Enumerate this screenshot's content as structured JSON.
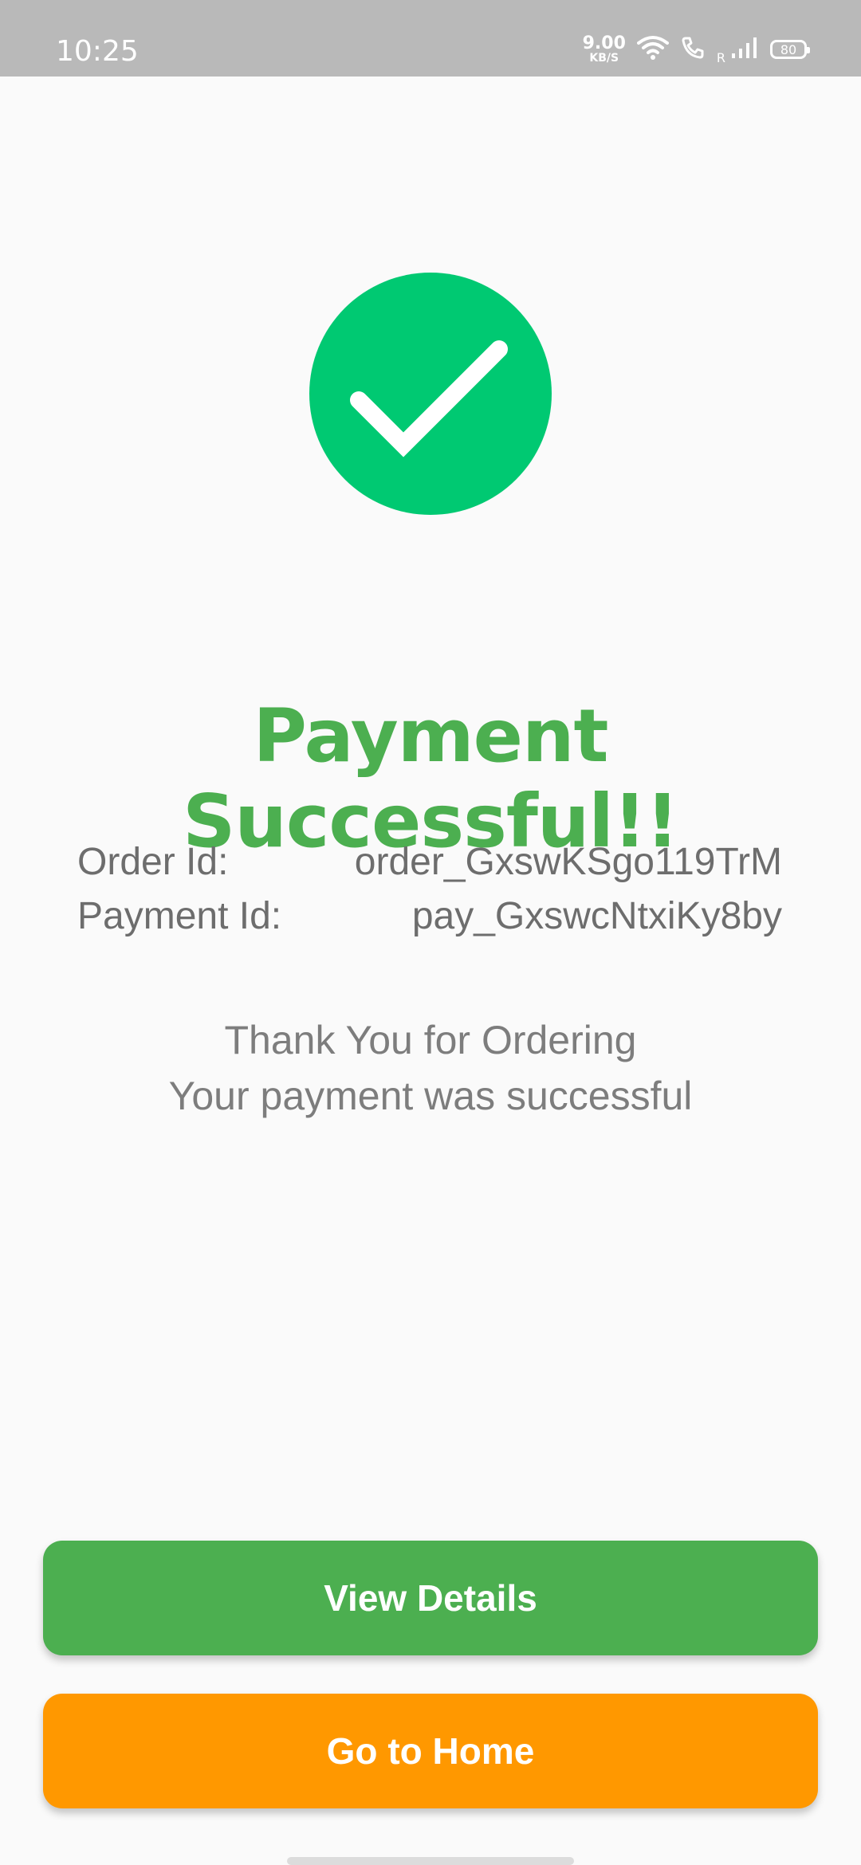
{
  "status_bar": {
    "time": "10:25",
    "net_speed_value": "9.00",
    "net_speed_unit": "KB/S",
    "roaming": "R",
    "battery": "80",
    "icons": [
      "wifi-icon",
      "call-icon",
      "signal-icon",
      "battery-icon"
    ]
  },
  "success": {
    "icon": "check-circle-icon",
    "color": "#00c972",
    "title": "Payment Successful!!",
    "title_color": "#4caf50"
  },
  "order": {
    "order_label": "Order Id:",
    "order_value": "order_GxswKSgo119TrM",
    "payment_label": "Payment Id:",
    "payment_value": "pay_GxswcNtxiKy8by"
  },
  "message": {
    "line1": "Thank You for Ordering",
    "line2": "Your payment was successful"
  },
  "buttons": {
    "view_details": "View Details",
    "view_details_color": "#4caf50",
    "go_home": "Go to Home",
    "go_home_color": "#ff9800"
  }
}
